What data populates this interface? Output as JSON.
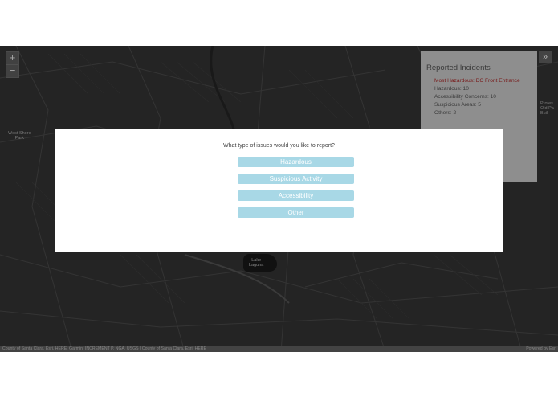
{
  "map": {
    "labels": {
      "west_park": [
        "West Shore",
        "Park"
      ],
      "lake": [
        "Lake",
        "Laguna"
      ],
      "edge_right": [
        "Protes",
        "Old Pa",
        "Buil"
      ]
    },
    "zoom_in": "+",
    "zoom_out": "−",
    "collapse": "»",
    "attribution": "County of Santa Clara, Esri, HERE, Garmin, INCREMENT P, NGA, USGS | County of Santa Clara, Esri, HERE",
    "powered_by": "Powered by Esri"
  },
  "panel": {
    "title": "Reported Incidents",
    "most_hazardous": "Most Hazardous: DC Front Entrance",
    "hazardous": "Hazardous: 10",
    "accessibility": "Accessibility Concerns: 10",
    "suspicious": "Suspicious Areas: 5",
    "others": "Others: 2"
  },
  "modal": {
    "question": "What type of issues would you like to report?",
    "options": [
      "Hazardous",
      "Suspicious Activity",
      "Accessibility",
      "Other"
    ]
  }
}
